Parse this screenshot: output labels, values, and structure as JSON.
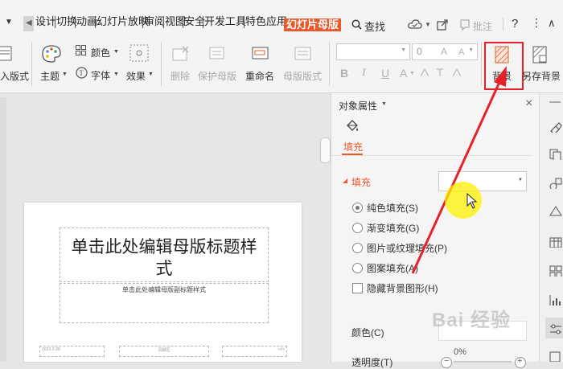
{
  "tabs": [
    "设计",
    "切换",
    "动画",
    "幻灯片放映",
    "审阅",
    "视图",
    "安全",
    "开发工具",
    "特色应用",
    "幻灯片母版"
  ],
  "topbar": {
    "search": "查找",
    "comment": "批注",
    "help": "?"
  },
  "ribbon": {
    "layout": "入版式",
    "theme": "主题",
    "color": "颜色",
    "font": "字体",
    "effect": "效果",
    "delete": "删除",
    "protect": "保护母版",
    "rename": "重命名",
    "master_layout": "母版版式",
    "font_size": "0",
    "format_btns": [
      "B",
      "I",
      "U",
      "A"
    ],
    "background": "背景",
    "save_background": "另存背景"
  },
  "panel": {
    "title": "对象属性",
    "tab_fill": "填充",
    "section": "填充",
    "options": [
      "纯色填充(S)",
      "渐变填充(G)",
      "图片或纹理填充(P)",
      "图案填充(A)"
    ],
    "hide_bg": "隐藏背景图形(H)",
    "color_label": "颜色(C)",
    "transparency_label": "透明度(T)",
    "transparency_value": "0%"
  },
  "slide": {
    "title": "单击此处编辑母版标题样式",
    "subtitle": "单击此处编辑母版副标题样式",
    "footer_date": "2023-2-28",
    "footer_text": "页脚区",
    "footer_num": "<#>"
  },
  "watermark": "Bai 经验",
  "colors": {
    "accent": "#e85a2c",
    "annotation": "#e8202a",
    "cursor": "#fff200"
  }
}
